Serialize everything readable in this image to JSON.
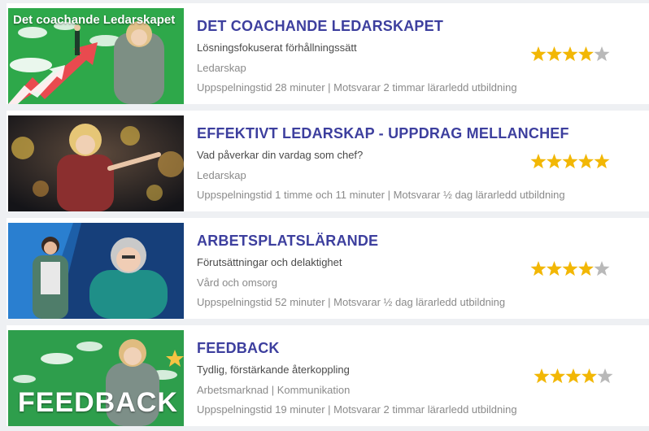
{
  "colors": {
    "title": "#3d3f9e",
    "star_on": "#f2b705",
    "star_off": "#b9b9b9",
    "green_thumb": "#2ea84a"
  },
  "courses": [
    {
      "thumb_title": "Det coachande Ledarskapet",
      "title": "DET COACHANDE LEDARSKAPET",
      "subtitle": "Lösningsfokuserat förhållningssätt",
      "category": "Ledarskap",
      "meta": "Uppspelningstid 28 minuter | Motsvarar 2 timmar lärarledd utbildning",
      "rating": 4
    },
    {
      "title": "EFFEKTIVT LEDARSKAP - UPPDRAG MELLANCHEF",
      "subtitle": "Vad påverkar din vardag som chef?",
      "category": "Ledarskap",
      "meta": "Uppspelningstid 1 timme och 11 minuter | Motsvarar ½ dag lärarledd utbildning",
      "rating": 5
    },
    {
      "title": "ARBETSPLATSLÄRANDE",
      "subtitle": "Förutsättningar och delaktighet",
      "category": "Vård och omsorg",
      "meta": "Uppspelningstid 52 minuter | Motsvarar ½ dag lärarledd utbildning",
      "rating": 4
    },
    {
      "thumb_title": "FEEDBACK",
      "title": "FEEDBACK",
      "subtitle": "Tydlig, förstärkande återkoppling",
      "category": "Arbetsmarknad | Kommunikation",
      "meta": "Uppspelningstid 19 minuter | Motsvarar 2 timmar lärarledd utbildning",
      "rating": 4
    }
  ]
}
